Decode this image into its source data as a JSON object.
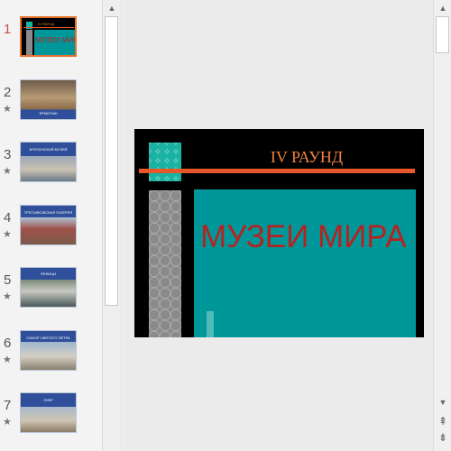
{
  "thumbnail_pane": {
    "slides": [
      {
        "number": "1",
        "caption_top": "IV РАУНД",
        "caption": "МУЗЕИ МИРА",
        "active": true,
        "has_star": false
      },
      {
        "number": "2",
        "caption": "ЭРМИТАЖ",
        "active": false,
        "has_star": true
      },
      {
        "number": "3",
        "caption": "БРИТАНСКИЙ МУЗЕЙ",
        "active": false,
        "has_star": true
      },
      {
        "number": "4",
        "caption": "ТРЕТЬЯКОВСКАЯ ГАЛЕРЕЯ",
        "active": false,
        "has_star": true
      },
      {
        "number": "5",
        "caption": "УФФИЦИ",
        "active": false,
        "has_star": true
      },
      {
        "number": "6",
        "caption": "СОБОР СВЯТОГО ПЕТРА",
        "active": false,
        "has_star": true
      },
      {
        "number": "7",
        "caption": "ЛУВР",
        "active": false,
        "has_star": true
      }
    ],
    "star_glyph": "★"
  },
  "slide": {
    "round_title": "IV РАУНД",
    "main_title": "МУЗЕИ МИРА"
  },
  "scrollbars": {
    "up_arrow": "▲",
    "down_arrow": "▼",
    "prev_slide": "⇞",
    "next_slide": "⇟"
  },
  "colors": {
    "active_border": "#e2732d",
    "teal": "#00979a",
    "orange_bar": "#e8572a",
    "title_red": "#b5231f",
    "round_title": "#f08040"
  }
}
